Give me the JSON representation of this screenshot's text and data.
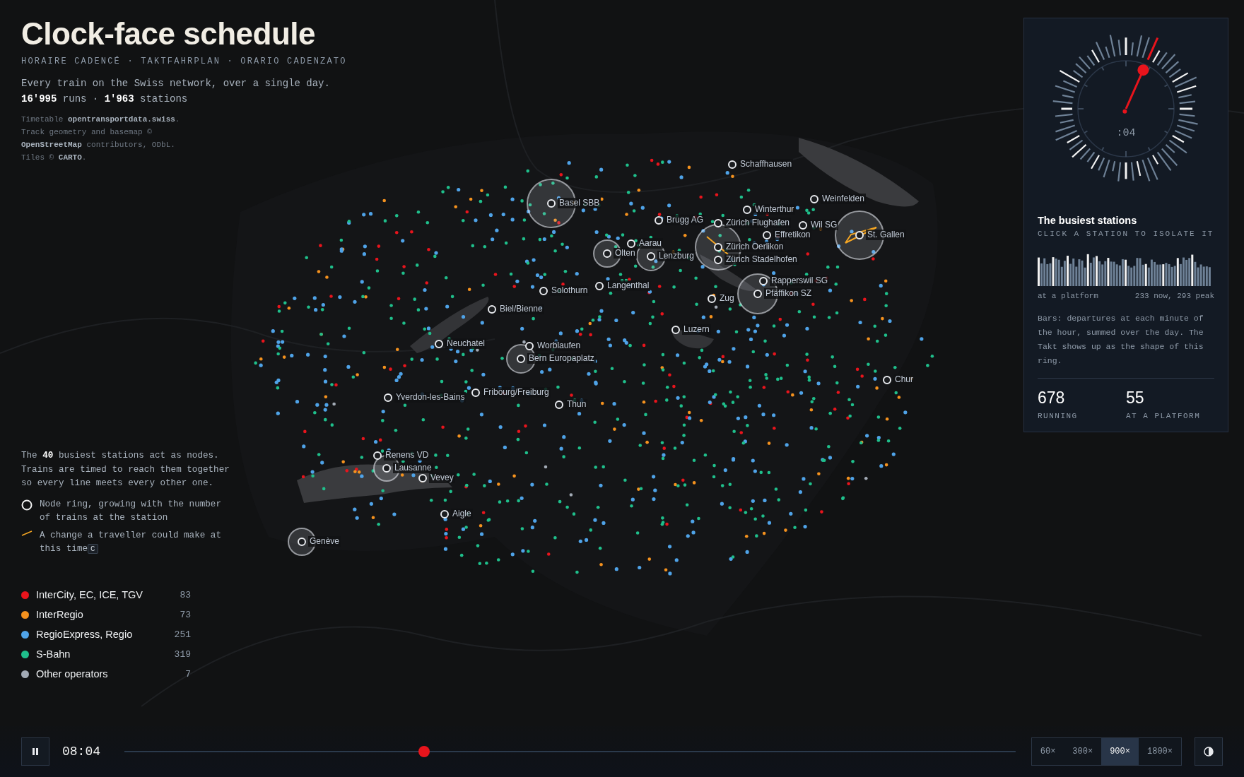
{
  "header": {
    "title": "Clock-face schedule",
    "subtitle": "HORAIRE CADENCÉ · TAKTFAHRPLAN · ORARIO CADENZATO",
    "description": "Every train on the Swiss network, over a single day.",
    "stats": "**16'995** runs · **1'963** stations",
    "credits": [
      "Timetable **opentransportdata.swiss**.",
      "Track geometry and basemap ©",
      "**OpenStreetMap** contributors, ODbL.",
      "Tiles © **CARTO**."
    ]
  },
  "explainer": {
    "text": "The **40** busiest stations act as nodes. Trains are timed to reach them together so every line meets every other one.",
    "keys": [
      {
        "kind": "ring",
        "text": "Node ring, growing with the number of trains at the station"
      },
      {
        "kind": "change",
        "text": "A change a traveller could make at this time",
        "key": "C"
      }
    ]
  },
  "legend": [
    {
      "label": "InterCity, EC, ICE, TGV",
      "count": "83",
      "color": "#e8141c"
    },
    {
      "label": "InterRegio",
      "count": "73",
      "color": "#f5921e"
    },
    {
      "label": "RegioExpress, Regio",
      "count": "251",
      "color": "#4fa3e8"
    },
    {
      "label": "S-Bahn",
      "count": "319",
      "color": "#1fbf8b"
    },
    {
      "label": "Other operators",
      "count": "7",
      "color": "#a3abb6"
    }
  ],
  "stations": [
    {
      "name": "Schaffhausen",
      "hub": false
    },
    {
      "name": "Weinfelden",
      "hub": false
    },
    {
      "name": "Basel SBB",
      "hub": true
    },
    {
      "name": "Winterthur",
      "hub": false
    },
    {
      "name": "Brugg AG",
      "hub": false
    },
    {
      "name": "Zürich Flughafen",
      "hub": false
    },
    {
      "name": "Wil SG",
      "hub": false
    },
    {
      "name": "Effretikon",
      "hub": false
    },
    {
      "name": "St. Gallen",
      "hub": true
    },
    {
      "name": "Aarau",
      "hub": false
    },
    {
      "name": "Zürich Oerlikon",
      "hub": true
    },
    {
      "name": "Olten",
      "hub": true
    },
    {
      "name": "Lenzburg",
      "hub": true
    },
    {
      "name": "Zürich Stadelhofen",
      "hub": false
    },
    {
      "name": "Rapperswil SG",
      "hub": false
    },
    {
      "name": "Langenthal",
      "hub": false
    },
    {
      "name": "Solothurn",
      "hub": false
    },
    {
      "name": "Pfäffikon SZ",
      "hub": true
    },
    {
      "name": "Zug",
      "hub": false
    },
    {
      "name": "Biel/Bienne",
      "hub": false
    },
    {
      "name": "Luzern",
      "hub": false
    },
    {
      "name": "Neuchatel",
      "hub": false
    },
    {
      "name": "Worblaufen",
      "hub": false
    },
    {
      "name": "Bern Europaplatz",
      "hub": true
    },
    {
      "name": "Chur",
      "hub": false
    },
    {
      "name": "Fribourg/Freiburg",
      "hub": false
    },
    {
      "name": "Yverdon-les-Bains",
      "hub": false
    },
    {
      "name": "Thun",
      "hub": false
    },
    {
      "name": "Renens VD",
      "hub": false
    },
    {
      "name": "Lausanne",
      "hub": true
    },
    {
      "name": "Vevey",
      "hub": false
    },
    {
      "name": "Aigle",
      "hub": false
    },
    {
      "name": "Genève",
      "hub": true
    }
  ],
  "panel": {
    "minute_label": ":04",
    "title": "The busiest stations",
    "hint": "CLICK A STATION TO ISOLATE IT",
    "bars_left": "at a platform",
    "bars_right": "233 now, 293 peak",
    "note": "Bars: departures at each minute of the hour, summed over the day. The Takt shows up as the shape of this ring.",
    "stats": [
      {
        "value": "678",
        "label": "RUNNING"
      },
      {
        "value": "55",
        "label": "AT A PLATFORM"
      }
    ]
  },
  "timeline": {
    "playing": true,
    "time": "08:04",
    "level": 0.336,
    "speeds": [
      {
        "label": "60×",
        "selected": false
      },
      {
        "label": "300×",
        "selected": false
      },
      {
        "label": "900×",
        "selected": true
      },
      {
        "label": "1800×",
        "selected": false
      }
    ]
  }
}
